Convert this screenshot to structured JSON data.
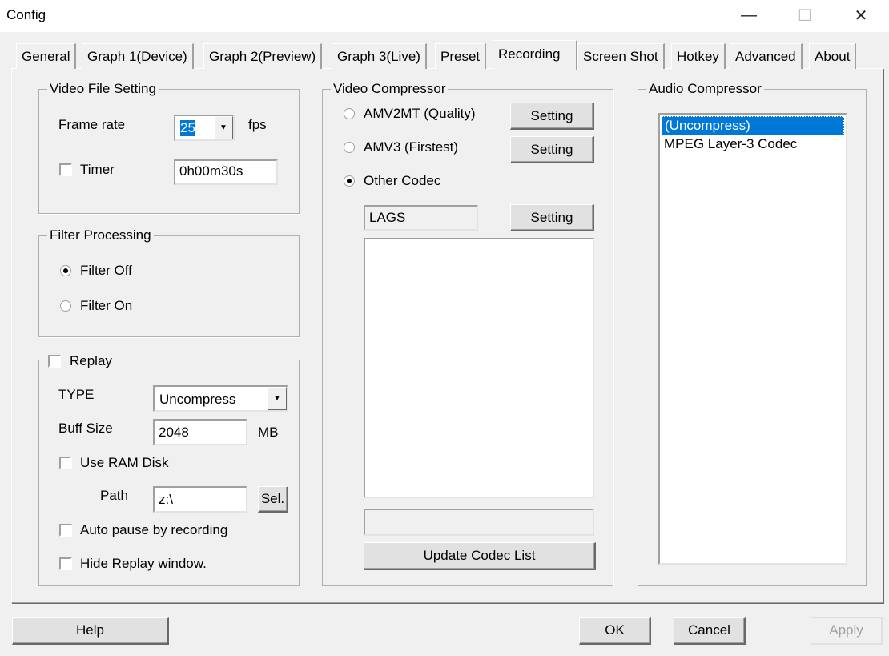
{
  "window": {
    "title": "Config",
    "minimize": "—",
    "maximize": "☐",
    "close": "✕"
  },
  "tabs": [
    "General",
    "Graph 1(Device)",
    "Graph 2(Preview)",
    "Graph 3(Live)",
    "Preset",
    "Recording",
    "Screen Shot",
    "Hotkey",
    "Advanced",
    "About"
  ],
  "video_file": {
    "title": "Video File Setting",
    "frame_rate_label": "Frame rate",
    "frame_rate": "25",
    "fps": "fps",
    "timer_label": "Timer",
    "timer_value": "0h00m30s"
  },
  "filter": {
    "title": "Filter Processing",
    "off": "Filter Off",
    "on": "Filter On"
  },
  "replay": {
    "title": "Replay",
    "type_label": "TYPE",
    "type_value": "Uncompress",
    "buff_label": "Buff Size",
    "buff_value": "2048",
    "buff_unit": "MB",
    "ram_disk": "Use RAM Disk",
    "path_label": "Path",
    "path_value": "z:\\",
    "sel": "Sel.",
    "auto_pause": "Auto pause by recording",
    "hide_window": "Hide Replay window."
  },
  "video_compressor": {
    "title": "Video Compressor",
    "amv2mt": "AMV2MT (Quality)",
    "amv3": "AMV3 (Firstest)",
    "other": "Other Codec",
    "setting": "Setting",
    "codec": "LAGS",
    "update": "Update Codec List"
  },
  "audio_compressor": {
    "title": "Audio Compressor",
    "items": [
      "(Uncompress)",
      "MPEG Layer-3 Codec"
    ]
  },
  "buttons": {
    "help": "Help",
    "ok": "OK",
    "cancel": "Cancel",
    "apply": "Apply"
  }
}
